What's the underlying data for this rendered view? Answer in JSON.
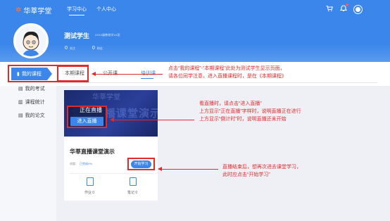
{
  "header": {
    "logo_text": "华莘学堂",
    "nav": [
      {
        "label": "学习中心",
        "active": true
      },
      {
        "label": "个人中心",
        "active": false
      }
    ]
  },
  "profile": {
    "name": "测试学生",
    "school": "2XXX级教育学XX班",
    "stats": [
      {
        "value": "0",
        "label": "关注"
      },
      {
        "value": "0",
        "label": "粉丝"
      }
    ]
  },
  "sidebar": {
    "items": [
      {
        "label": "我的课程",
        "active": true
      },
      {
        "label": "我的考试",
        "active": false
      },
      {
        "label": "课程统计",
        "active": false
      },
      {
        "label": "我的论文",
        "active": false
      }
    ]
  },
  "tabs": [
    {
      "label": "本期课程",
      "active": false
    },
    {
      "label": "公开课",
      "active": false
    },
    {
      "label": "培训课",
      "active": true
    }
  ],
  "course": {
    "title": "华莘直播课堂演示",
    "image_text": "华莘直播课堂演示",
    "live_status": "正在直播",
    "enter_live": "进入直播",
    "progress_label": "进度：",
    "progress_value": "已完成0%",
    "study_button": "开始学习",
    "homework_label": "作业",
    "homework_count": "0",
    "notes_label": "笔记",
    "notes_count": "0"
  },
  "annotations": {
    "note1_line1": "点击“我的课程”-“本期课程”此处为测试学生显示页面，",
    "note1_line2": "请各位同学注意，进入直播课程时，是在《本期课程》",
    "note2_line1": "看直播时，请点击“进入直播”",
    "note2_line2": "上方显示“正在直播”字样时，说明直播正在进行",
    "note2_line3": "上方显示“倒计时”时，说明直播还未开始",
    "note3_line1": "直播结束后，想再次进去课堂学习，",
    "note3_line2": "此时应点击“开始学习”"
  },
  "colors": {
    "primary": "#3a86ea",
    "annotation": "#e12b2b",
    "logo_accent": "#ff7a3c"
  }
}
